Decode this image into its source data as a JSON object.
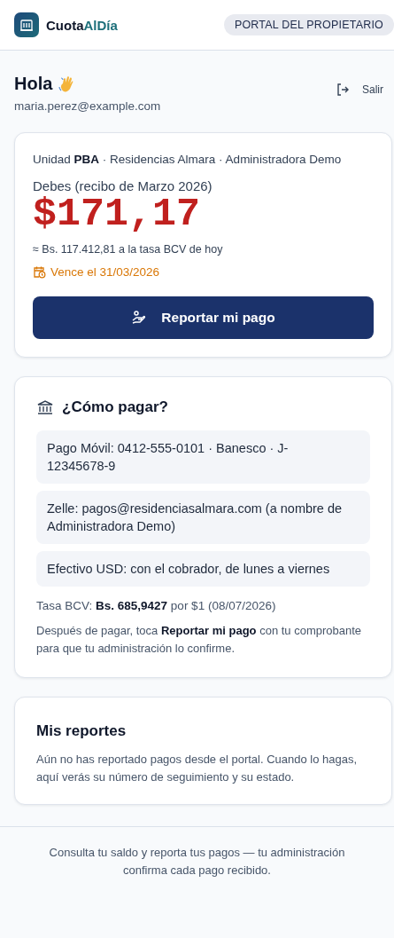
{
  "header": {
    "brand": {
      "name": "Cuota",
      "accent": "AlDía"
    },
    "badge": "PORTAL DEL PROPIETARIO"
  },
  "user": {
    "greeting": "Hola",
    "email": "maria.perez@example.com",
    "logout": "Salir"
  },
  "balance": {
    "unit_line": "Unidad **PBA** · Residencias Almara · Administradora Demo",
    "label": "Debes (recibo de Marzo 2026)",
    "amount": "$171,17",
    "conversion": "≈ Bs. 117.412,81 a la tasa BCV de hoy",
    "due": "Vence el 31/03/2026",
    "button": "Reportar mi pago"
  },
  "how_to_pay": {
    "title": "¿Cómo pagar?",
    "methods": [
      {
        "text": "Pago Móvil: 0412-555-0101 · Banesco · J-12345678-9"
      },
      {
        "text": "Zelle: pagos@residenciasalmara.com (a nombre de Administradora Demo)"
      },
      {
        "text": "Efectivo USD: con el cobrador, de lunes a viernes"
      }
    ],
    "rate": "Tasa BCV: **Bs. 685,9427** por $1 (08/07/2026)",
    "note": "Después de pagar, toca **Reportar mi pago** con tu comprobante para que tu administración lo confirme."
  },
  "reports": {
    "title": "Mis reportes",
    "empty": "Aún no has reportado pagos desde el portal. Cuando lo hagas, aquí verás su número de seguimiento y su estado."
  },
  "footer": "Consulta tu saldo y reporta tus pagos — tu administración confirma cada pago recibido."
}
